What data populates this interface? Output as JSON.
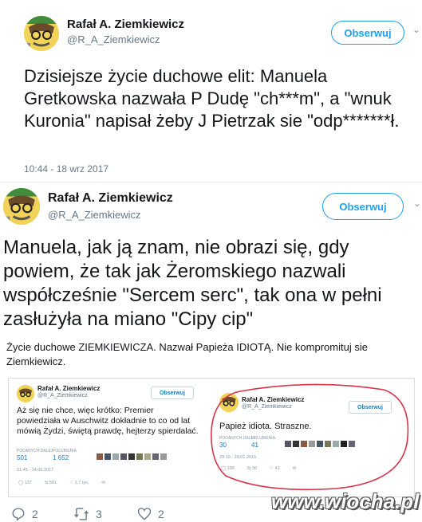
{
  "tweet1": {
    "name": "Rafał A. Ziemkiewicz",
    "handle": "@R_A_Ziemkiewicz",
    "follow_label": "Obserwuj",
    "text": "Dzisiejsze życie duchowe elit: Manuela Gretkowska nazwała P Dudę \"ch***m\", a \"wnuk Kuronia\" napisał żeby J Pietrzak sie \"odp*******ł.",
    "timestamp": "10:44 - 18 wrz 2017"
  },
  "tweet2": {
    "name": "Rafał A. Ziemkiewicz",
    "handle": "@R_A_Ziemkiewicz",
    "follow_label": "Obserwuj",
    "text": "Manuela, jak ją znam, nie obrazi się, gdy powiem, że tak jak Żeromskiego nazwali współcześnie \"Sercem serc\", tak ona w pełni zasłużyła na miano \"Cipy cip\""
  },
  "caption": "Życie duchowe ZIEMKIEWICZA. Nazwał Papieża IDIOTĄ. Nie kompromituj sie Ziemkiewicz.",
  "embedded_left": {
    "name": "Rafał A. Ziemkiewicz",
    "handle": "@R_A_Ziemkiewicz",
    "follow_label": "Obserwuj",
    "text": "Aż się nie chce, więc krótko: Premier powiedziała w Auschwitz dokładnie to co od lat mówią Żydzi, świętą prawdę, hejterzy spierdalać.",
    "retweets_label": "PODANYCH DALEJ",
    "likes_label": "POLUBIENIA",
    "retweets": "501",
    "likes": "1 652",
    "timestamp": "21:45 - 14.06.2017",
    "reply_count": "137",
    "rt_count": "501",
    "like_count": "1,7 tys."
  },
  "embedded_right": {
    "name": "Rafał A. Ziemkiewicz",
    "handle": "@R_A_Ziemkiewicz",
    "follow_label": "Obserwuj",
    "text": "Papież idiota. Straszne.",
    "retweets_label": "PODANYCH DALEJ",
    "likes_label": "POLUBIENIA",
    "retweets": "30",
    "likes": "41",
    "timestamp": "23:19 - 20.01.2015",
    "reply_count": "100",
    "rt_count": "30",
    "like_count": "41",
    "highlight_color": "#d8344a"
  },
  "actions": {
    "replies": "2",
    "retweets": "3",
    "likes": "2"
  },
  "watermark": "www.wiocha.pl",
  "colors": {
    "accent": "#1da1f2",
    "text": "#14171a",
    "secondary": "#657786"
  }
}
